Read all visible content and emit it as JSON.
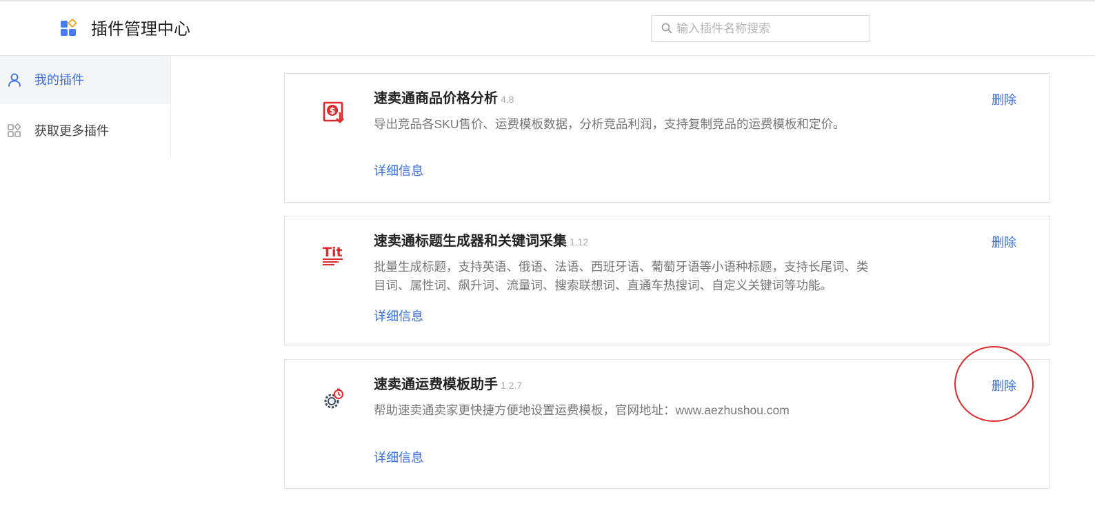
{
  "header": {
    "title": "插件管理中心",
    "search_placeholder": "输入插件名称搜索"
  },
  "sidebar": {
    "items": [
      {
        "label": "我的插件",
        "icon": "user-icon",
        "active": true
      },
      {
        "label": "获取更多插件",
        "icon": "grid-apps-icon",
        "active": false
      }
    ]
  },
  "plugins": [
    {
      "name": "速卖通商品价格分析",
      "version": "4.8",
      "description": "导出竞品各SKU售价、运费模板数据，分析竞品利润，支持复制竞品的运费模板和定价。",
      "detail_label": "详细信息",
      "delete_label": "删除",
      "icon": "price-analysis-icon"
    },
    {
      "name": "速卖通标题生成器和关键词采集",
      "version": "1.12",
      "description": "批量生成标题，支持英语、俄语、法语、西班牙语、葡萄牙语等小语种标题，支持长尾词、类目词、属性词、飙升词、流量词、搜索联想词、直通车热搜词、自定义关键词等功能。",
      "detail_label": "详细信息",
      "delete_label": "删除",
      "icon": "title-generator-icon",
      "icon_text": "Tit"
    },
    {
      "name": "速卖通运费模板助手",
      "version": "1.2.7",
      "description": "帮助速卖通卖家更快捷方便地设置运费模板，官网地址：www.aezhushou.com",
      "detail_label": "详细信息",
      "delete_label": "删除",
      "icon": "gear-timer-icon"
    }
  ],
  "colors": {
    "accent": "#3a6fe0",
    "highlight_circle": "#e02828",
    "icon_red": "#e0292b"
  }
}
